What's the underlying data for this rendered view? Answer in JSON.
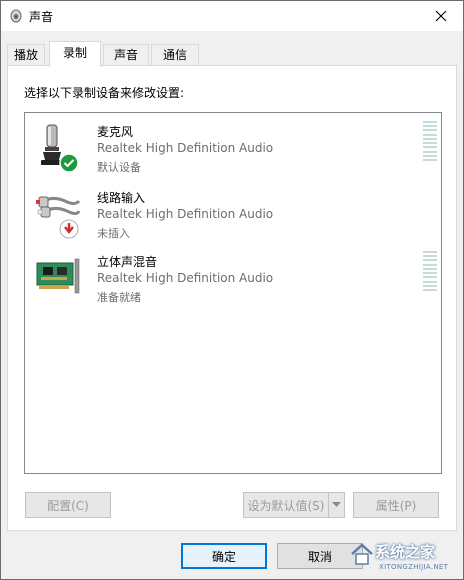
{
  "window": {
    "title": "声音"
  },
  "tabs": [
    {
      "label": "播放",
      "active": false
    },
    {
      "label": "录制",
      "active": true
    },
    {
      "label": "声音",
      "active": false
    },
    {
      "label": "通信",
      "active": false
    }
  ],
  "recording": {
    "instruction": "选择以下录制设备来修改设置:",
    "devices": [
      {
        "name": "麦克风",
        "description": "Realtek High Definition Audio",
        "status": "默认设备",
        "icon": "microphone-icon",
        "badge": "green-check-badge"
      },
      {
        "name": "线路输入",
        "description": "Realtek High Definition Audio",
        "status": "未插入",
        "icon": "rca-cable-icon",
        "badge": "red-down-arrow-badge"
      },
      {
        "name": "立体声混音",
        "description": "Realtek High Definition Audio",
        "status": "准备就绪",
        "icon": "sound-card-icon",
        "badge": ""
      }
    ]
  },
  "buttons": {
    "configure": "配置(C)",
    "set_default": "设为默认值(S)",
    "properties": "属性(P)",
    "ok": "确定",
    "cancel": "取消"
  },
  "watermark": {
    "text": "系统之家",
    "sub": "XITONGZHIJIA.NET"
  },
  "colors": {
    "accent": "#0078d7",
    "meter": "#c4dcd9",
    "panel_border": "#d9d9d9"
  }
}
